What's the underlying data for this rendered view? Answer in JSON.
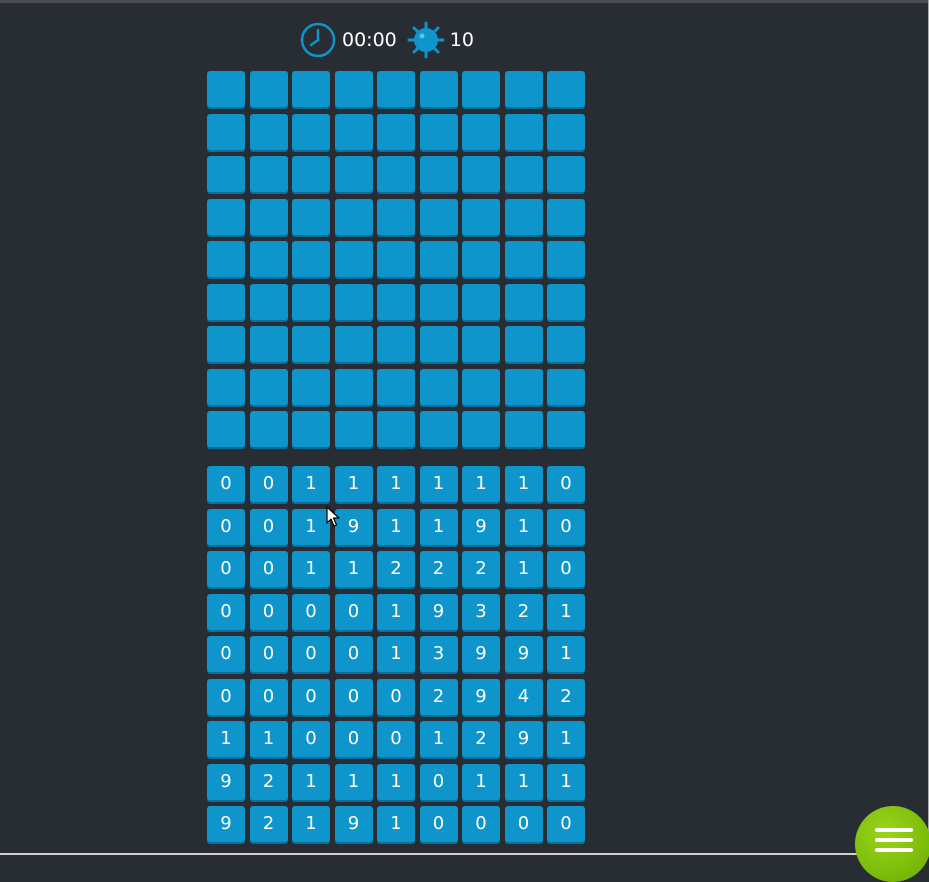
{
  "header": {
    "timer": "00:00",
    "mine_count": "10",
    "timer_icon": "clock-icon",
    "mine_icon": "mine-icon",
    "icon_color": "#0d95cc"
  },
  "hidden_board": {
    "rows": 9,
    "cols": 9,
    "tile_color": "#0d95cc"
  },
  "revealed_board": {
    "rows": [
      [
        "0",
        "0",
        "1",
        "1",
        "1",
        "1",
        "1",
        "1",
        "0"
      ],
      [
        "0",
        "0",
        "1",
        "9",
        "1",
        "1",
        "9",
        "1",
        "0"
      ],
      [
        "0",
        "0",
        "1",
        "1",
        "2",
        "2",
        "2",
        "1",
        "0"
      ],
      [
        "0",
        "0",
        "0",
        "0",
        "1",
        "9",
        "3",
        "2",
        "1"
      ],
      [
        "0",
        "0",
        "0",
        "0",
        "1",
        "3",
        "9",
        "9",
        "1"
      ],
      [
        "0",
        "0",
        "0",
        "0",
        "0",
        "2",
        "9",
        "4",
        "2"
      ],
      [
        "1",
        "1",
        "0",
        "0",
        "0",
        "1",
        "2",
        "9",
        "1"
      ],
      [
        "9",
        "2",
        "1",
        "1",
        "1",
        "0",
        "1",
        "1",
        "1"
      ],
      [
        "9",
        "2",
        "1",
        "9",
        "1",
        "0",
        "0",
        "0",
        "0"
      ]
    ]
  },
  "menu": {
    "icon": "hamburger-menu-icon",
    "color": "#7dbd0b"
  },
  "colors": {
    "background": "#282c33",
    "tile": "#0d95cc",
    "tile_shadow": "#0a6f9a",
    "text": "#ffffff"
  }
}
